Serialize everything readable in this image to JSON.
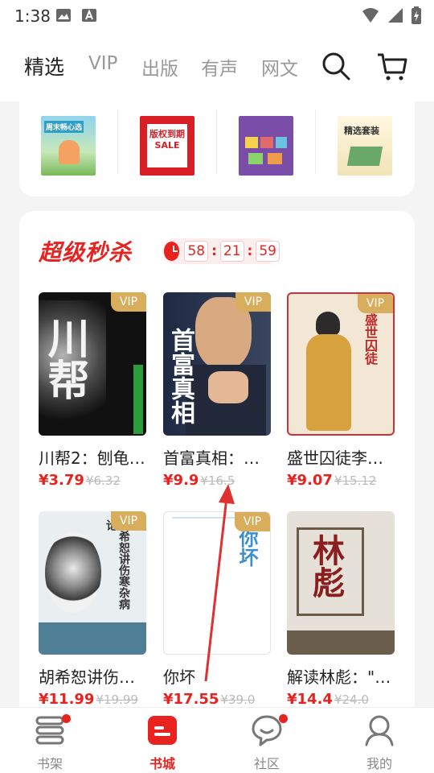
{
  "status_bar": {
    "time": "1:38"
  },
  "top_tabs": [
    {
      "label": "精选",
      "active": true
    },
    {
      "label": "VIP"
    },
    {
      "label": "出版"
    },
    {
      "label": "有声"
    },
    {
      "label": "网文"
    }
  ],
  "categories": [
    {
      "cover_text": "周末畅心选"
    },
    {
      "cover_text": "版权到期 SALE"
    },
    {
      "cover_text": ""
    },
    {
      "cover_text": "精选套装"
    }
  ],
  "flash_sale": {
    "title": "超级秒杀",
    "timer": {
      "h": "58",
      "m": "21",
      "s": "59"
    },
    "vip_badge": "VIP",
    "books": [
      {
        "title": "川帮2：刨龟…",
        "price": "¥3.79",
        "original": "¥6.32",
        "cover_text": "川帮"
      },
      {
        "title": "首富真相：…",
        "price": "¥9.9",
        "original": "¥16.5",
        "cover_text": "首富真相"
      },
      {
        "title": "盛世囚徒李…",
        "price": "¥9.07",
        "original": "¥15.12",
        "cover_text": "盛世囚徒"
      },
      {
        "title": "胡希恕讲伤…",
        "price": "¥11.99",
        "original": "¥19.99",
        "cover_text": "胡希恕讲伤寒杂病论"
      },
      {
        "title": "你坏",
        "price": "¥17.55",
        "original": "¥39.0",
        "cover_text": "你坏"
      },
      {
        "title": "解读林彪：\"…",
        "price": "¥14.4",
        "original": "¥24.0",
        "cover_text": "林彪"
      }
    ]
  },
  "bottom_nav": [
    {
      "label": "书架",
      "badge": true
    },
    {
      "label": "书城",
      "active": true
    },
    {
      "label": "社区",
      "badge": true
    },
    {
      "label": "我的"
    }
  ],
  "colors": {
    "accent": "#e8231f",
    "vip": "#d8ad5b"
  }
}
